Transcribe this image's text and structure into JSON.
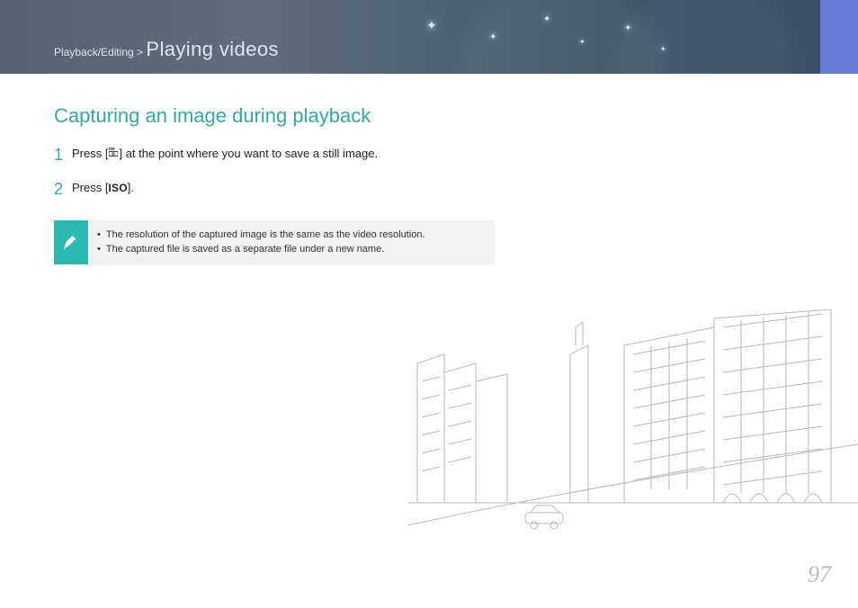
{
  "header": {
    "breadcrumb_section": "Playback/Editing",
    "breadcrumb_sep": " > ",
    "title": "Playing videos"
  },
  "section": {
    "heading": "Capturing an image during playback",
    "steps": [
      {
        "num": "1",
        "pre": "Press [",
        "icon_label": "OK/record-icon",
        "post": "] at the point where you want to save a still image."
      },
      {
        "num": "2",
        "pre": "Press [",
        "icon_label": "ISO",
        "post": "]."
      }
    ],
    "notes": [
      "The resolution of the captured image is the same as the video resolution.",
      "The captured file is saved as a separate file under a new name."
    ]
  },
  "page_number": "97"
}
